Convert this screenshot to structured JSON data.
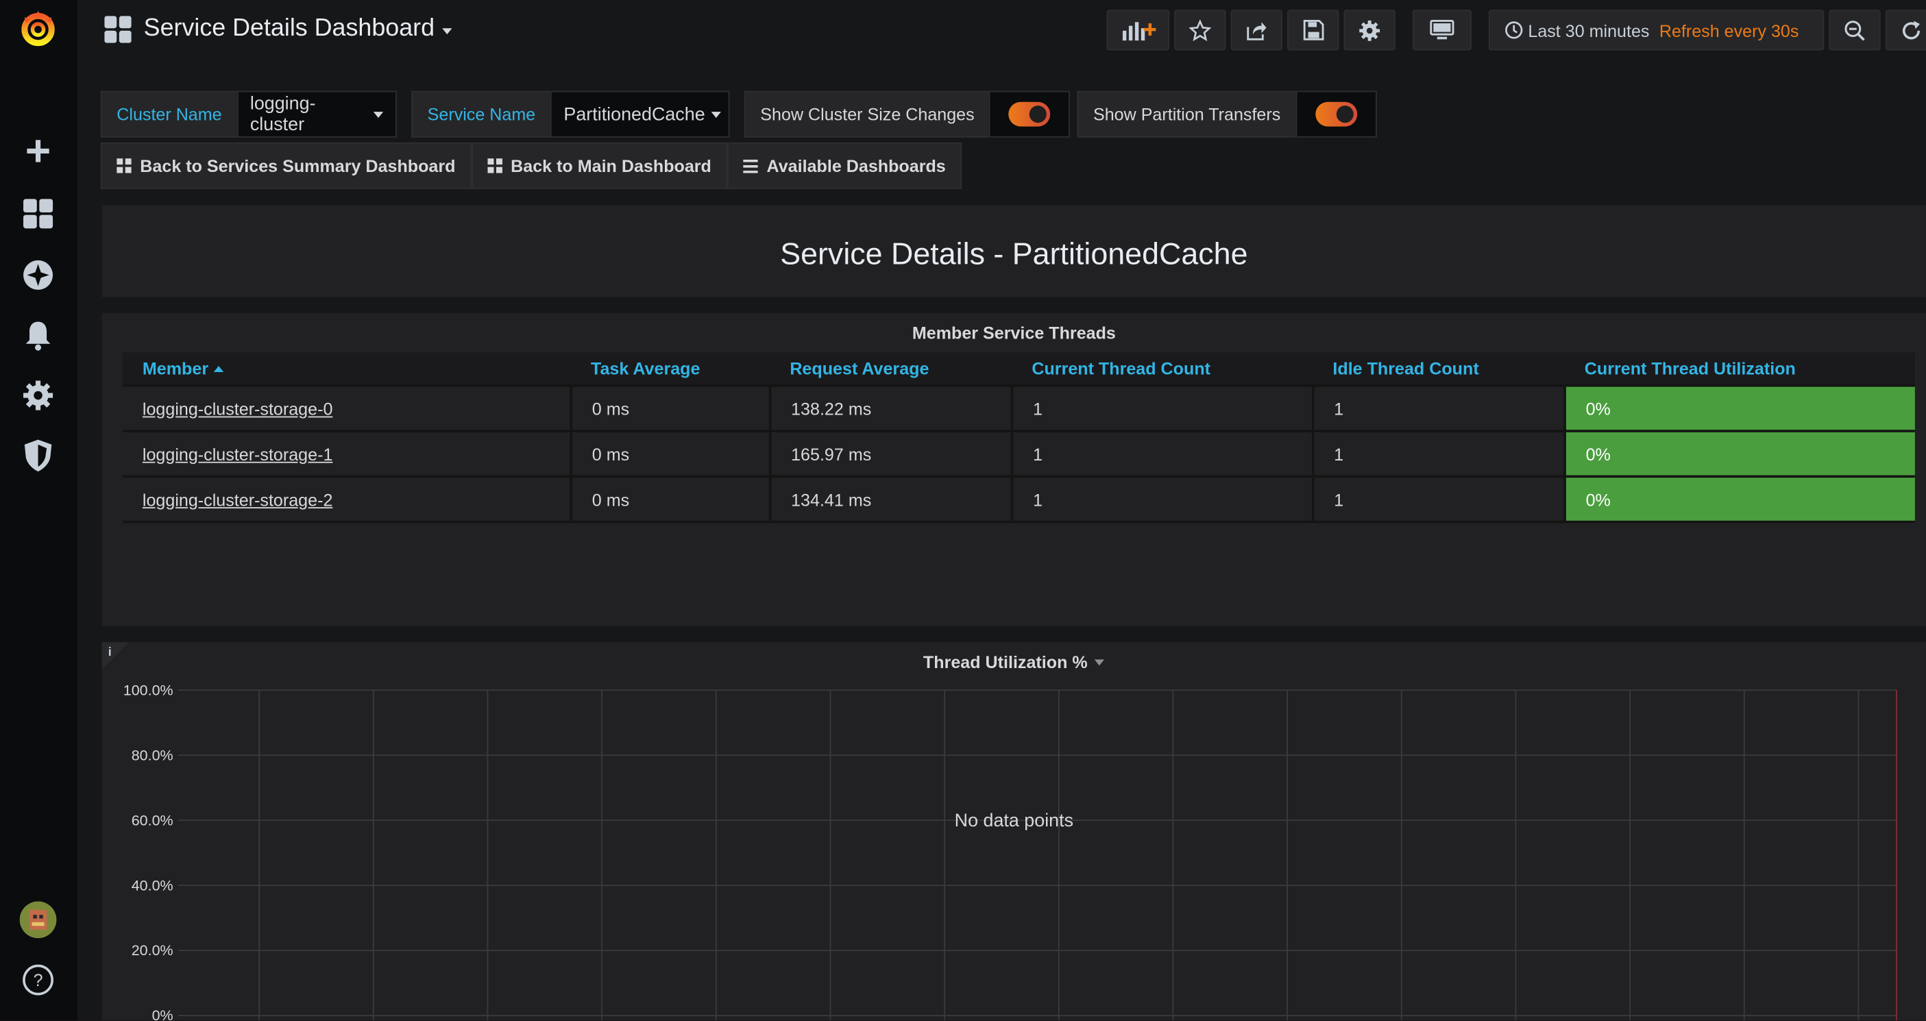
{
  "navbar": {
    "dashboard_title": "Service Details Dashboard",
    "time_range": "Last 30 minutes",
    "refresh": "Refresh every 30s"
  },
  "variables": {
    "cluster_label": "Cluster Name",
    "cluster_value": "logging-cluster",
    "service_label": "Service Name",
    "service_value": "PartitionedCache",
    "cluster_size_label": "Show Cluster Size Changes",
    "cluster_size_on": true,
    "partition_transfers_label": "Show Partition Transfers",
    "partition_transfers_on": true
  },
  "links": [
    {
      "label": "Back to Services Summary Dashboard",
      "icon": "dashboard-grid-icon"
    },
    {
      "label": "Back to Main Dashboard",
      "icon": "dashboard-grid-icon"
    },
    {
      "label": "Available Dashboards",
      "icon": "list-icon"
    }
  ],
  "text_panel": {
    "title": "Service Details - PartitionedCache"
  },
  "table_panel": {
    "title": "Member Service Threads",
    "columns": [
      "Member",
      "Task Average",
      "Request Average",
      "Current Thread Count",
      "Idle Thread Count",
      "Current Thread Utilization"
    ],
    "rows": [
      [
        "logging-cluster-storage-0",
        "0 ms",
        "138.22 ms",
        "1",
        "1",
        "0%"
      ],
      [
        "logging-cluster-storage-1",
        "0 ms",
        "165.97 ms",
        "1",
        "1",
        "0%"
      ],
      [
        "logging-cluster-storage-2",
        "0 ms",
        "134.41 ms",
        "1",
        "1",
        "0%"
      ]
    ],
    "utilization_color": "#4a9e3e"
  },
  "graph_panel": {
    "info": "i",
    "title": "Thread Utilization %",
    "no_data": "No data points"
  },
  "chart_data": {
    "type": "line",
    "title": "Thread Utilization %",
    "series": [],
    "yticks": [
      "100.0%",
      "80.0%",
      "60.0%",
      "40.0%",
      "20.0%",
      "0%"
    ],
    "ylim": [
      0,
      100
    ],
    "grid": true
  },
  "colors": {
    "accent": "#eb7b18",
    "link_blue": "#33b5e5",
    "panel_bg": "#212124",
    "page_bg": "#161719"
  }
}
